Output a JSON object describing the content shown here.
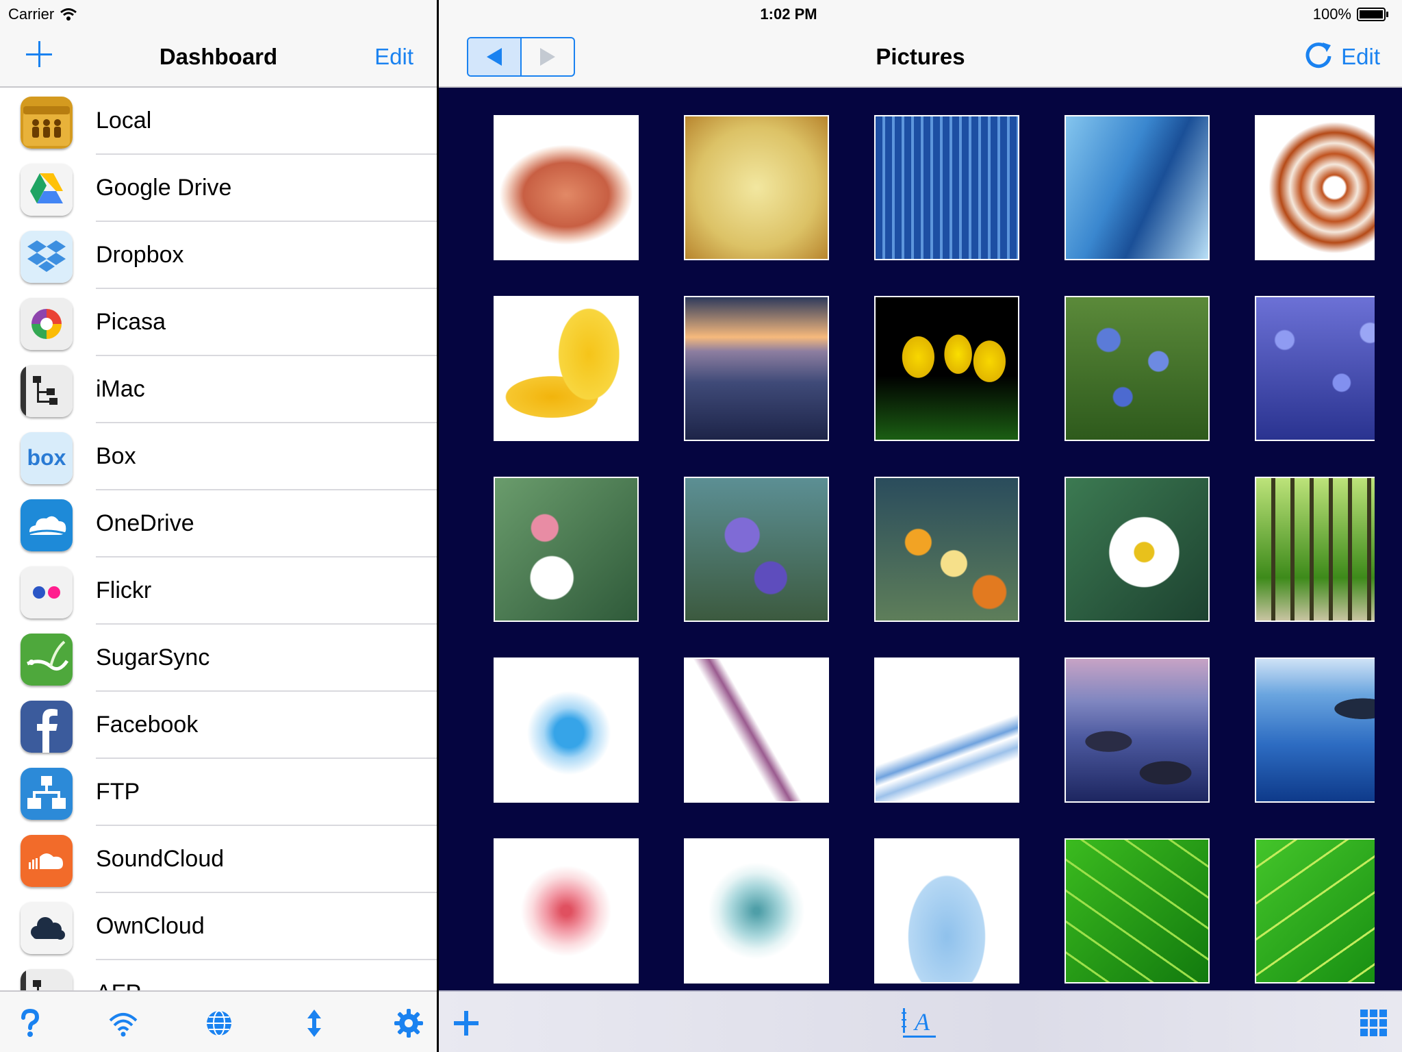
{
  "status": {
    "carrier": "Carrier",
    "time": "1:02 PM",
    "battery": "100%"
  },
  "sidebar": {
    "title": "Dashboard",
    "edit_label": "Edit",
    "items": [
      {
        "label": "Local",
        "icon": "local-folder-icon"
      },
      {
        "label": "Google Drive",
        "icon": "google-drive-icon"
      },
      {
        "label": "Dropbox",
        "icon": "dropbox-icon"
      },
      {
        "label": "Picasa",
        "icon": "picasa-icon"
      },
      {
        "label": "iMac",
        "icon": "network-computer-icon"
      },
      {
        "label": "Box",
        "icon": "box-icon"
      },
      {
        "label": "OneDrive",
        "icon": "onedrive-icon"
      },
      {
        "label": "Flickr",
        "icon": "flickr-icon"
      },
      {
        "label": "SugarSync",
        "icon": "sugarsync-icon"
      },
      {
        "label": "Facebook",
        "icon": "facebook-icon"
      },
      {
        "label": "FTP",
        "icon": "ftp-icon"
      },
      {
        "label": "SoundCloud",
        "icon": "soundcloud-icon"
      },
      {
        "label": "OwnCloud",
        "icon": "owncloud-icon"
      },
      {
        "label": "AFP",
        "icon": "network-computer-icon"
      }
    ],
    "toolbar": [
      "help-icon",
      "wifi-icon",
      "globe-icon",
      "transfer-icon",
      "settings-icon"
    ]
  },
  "browser": {
    "title": "Pictures",
    "edit_label": "Edit",
    "thumbnails": [
      "sea-urchin",
      "parchment-texture",
      "skyscraper-glass",
      "skyscraper-sky",
      "nautilus-shell",
      "yellow-leaves",
      "desert-dunes",
      "yellow-tulips",
      "blue-wildflowers",
      "purple-flower-field",
      "white-blossoms",
      "purple-borage",
      "orange-yellow-flowers",
      "white-daffodil",
      "green-forest",
      "blue-fractal",
      "purple-fractal",
      "blue-lines",
      "rocky-lake",
      "blue-lake-rocks",
      "red-skeleton-flower",
      "teal-leaf-star",
      "blue-skeleton-leaf",
      "green-leaf",
      "green-leaf-veins"
    ],
    "toolbar": [
      "add-icon",
      "sort-by-name-icon",
      "grid-view-icon"
    ]
  },
  "colors": {
    "accent": "#1a82f0",
    "grid_background": "#050540"
  }
}
